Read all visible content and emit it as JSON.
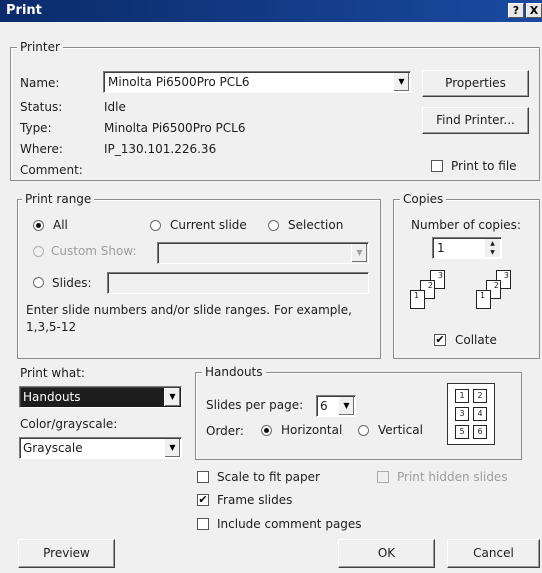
{
  "window": {
    "title": "Print",
    "help": "?",
    "close": "X"
  },
  "printer": {
    "legend": "Printer",
    "name_label": "Name:",
    "name_value": "Minolta Pi6500Pro PCL6",
    "status_label": "Status:",
    "status_value": "Idle",
    "type_label": "Type:",
    "type_value": "Minolta Pi6500Pro PCL6",
    "where_label": "Where:",
    "where_value": "IP_130.101.226.36",
    "comment_label": "Comment:",
    "comment_value": "",
    "properties": "Properties",
    "find_printer": "Find Printer...",
    "print_to_file": "Print to file"
  },
  "range": {
    "legend": "Print range",
    "all": "All",
    "current_slide": "Current slide",
    "selection": "Selection",
    "custom_show": "Custom Show:",
    "slides": "Slides:",
    "hint_line1": "Enter slide numbers and/or slide ranges. For example,",
    "hint_line2": "1,3,5-12"
  },
  "copies": {
    "legend": "Copies",
    "number_label": "Number of copies:",
    "number_value": "1",
    "collate": "Collate",
    "stack_pages": [
      "1",
      "2",
      "3"
    ]
  },
  "print_what": {
    "label": "Print what:",
    "value": "Handouts"
  },
  "color": {
    "label": "Color/grayscale:",
    "value": "Grayscale"
  },
  "handouts": {
    "legend": "Handouts",
    "per_page_label": "Slides per page:",
    "per_page_value": "6",
    "order_label": "Order:",
    "horizontal": "Horizontal",
    "vertical": "Vertical",
    "preview_cells": [
      "1",
      "2",
      "3",
      "4",
      "5",
      "6"
    ]
  },
  "options": {
    "scale": "Scale to fit paper",
    "frame": "Frame slides",
    "comments": "Include comment pages",
    "hidden": "Print hidden slides",
    "check_mark": "✔"
  },
  "buttons": {
    "preview": "Preview",
    "ok": "OK",
    "cancel": "Cancel"
  },
  "glyphs": {
    "dropdown": "▼",
    "spin_up": "▲",
    "spin_down": "▼"
  }
}
